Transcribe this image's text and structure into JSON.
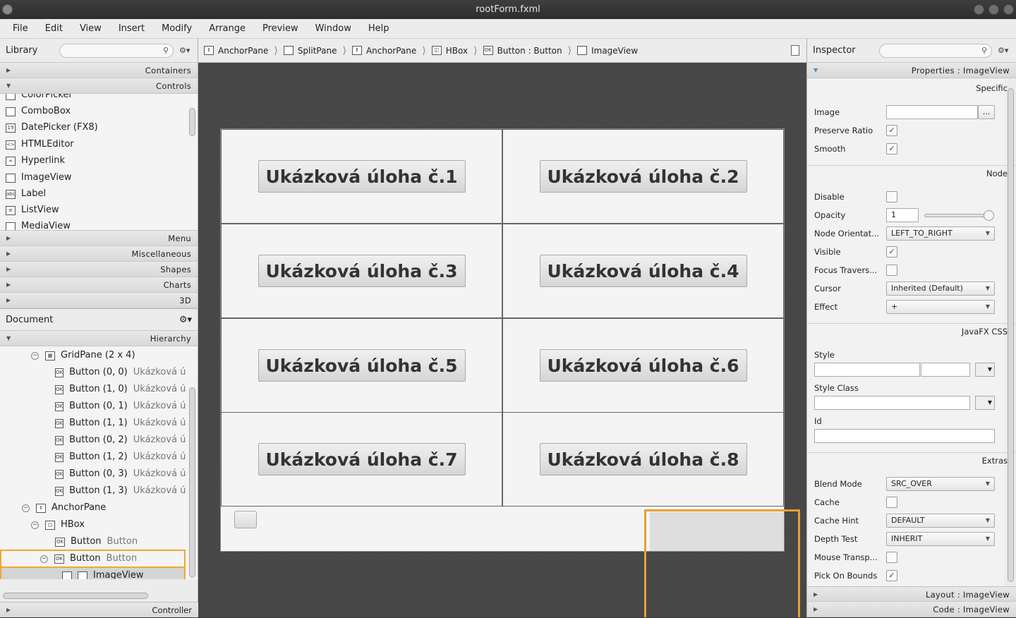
{
  "window": {
    "title": "rootForm.fxml"
  },
  "menu": [
    "File",
    "Edit",
    "View",
    "Insert",
    "Modify",
    "Arrange",
    "Preview",
    "Window",
    "Help"
  ],
  "library": {
    "title": "Library",
    "sections_top": [
      "Containers",
      "Controls"
    ],
    "items": [
      "ColorPicker",
      "ComboBox",
      "DatePicker  (FX8)",
      "HTMLEditor",
      "Hyperlink",
      "ImageView",
      "Label",
      "ListView",
      "MediaView"
    ],
    "item_icons": [
      "color-picker-icon",
      "combobox-icon",
      "datepicker-icon",
      "htmleditor-icon",
      "hyperlink-icon",
      "imageview-icon",
      "label-icon",
      "listview-icon",
      "mediaview-icon"
    ],
    "sections_bottom": [
      "Menu",
      "Miscellaneous",
      "Shapes",
      "Charts",
      "3D"
    ]
  },
  "document": {
    "title": "Document",
    "hierarchy_label": "Hierarchy",
    "rows": [
      {
        "label": "GridPane (2 x 4)",
        "caption": ""
      },
      {
        "label": "Button (0, 0)",
        "caption": "Ukázková ú"
      },
      {
        "label": "Button (1, 0)",
        "caption": "Ukázková ú"
      },
      {
        "label": "Button (0, 1)",
        "caption": "Ukázková ú"
      },
      {
        "label": "Button (1, 1)",
        "caption": "Ukázková ú"
      },
      {
        "label": "Button (0, 2)",
        "caption": "Ukázková ú"
      },
      {
        "label": "Button (1, 2)",
        "caption": "Ukázková ú"
      },
      {
        "label": "Button (0, 3)",
        "caption": "Ukázková ú"
      },
      {
        "label": "Button (1, 3)",
        "caption": "Ukázková ú"
      },
      {
        "label": "AnchorPane",
        "caption": ""
      },
      {
        "label": "HBox",
        "caption": ""
      },
      {
        "label": "Button",
        "caption": "Button"
      },
      {
        "label": "Button",
        "caption": "Button"
      },
      {
        "label": "ImageView",
        "caption": ""
      }
    ],
    "controller_label": "Controller"
  },
  "breadcrumb": [
    "AnchorPane",
    "SplitPane",
    "AnchorPane",
    "HBox",
    "Button : Button",
    "ImageView"
  ],
  "canvas": {
    "buttons": [
      "Ukázková úloha č.1",
      "Ukázková úloha č.2",
      "Ukázková úloha č.3",
      "Ukázková úloha č.4",
      "Ukázková úloha č.5",
      "Ukázková úloha č.6",
      "Ukázková úloha č.7",
      "Ukázková úloha č.8"
    ]
  },
  "inspector": {
    "title": "Inspector",
    "properties_label": "Properties : ImageView",
    "specific_label": "Specific",
    "image_label": "Image",
    "image_browse": "...",
    "preserve_label": "Preserve Ratio",
    "smooth_label": "Smooth",
    "node_label": "Node",
    "disable_label": "Disable",
    "opacity_label": "Opacity",
    "opacity_value": "1",
    "orient_label": "Node Orientat...",
    "orient_value": "LEFT_TO_RIGHT",
    "visible_label": "Visible",
    "focus_label": "Focus Travers...",
    "cursor_label": "Cursor",
    "cursor_value": "Inherited (Default)",
    "effect_label": "Effect",
    "effect_value": "+",
    "css_label": "JavaFX CSS",
    "style_label": "Style",
    "styleclass_label": "Style Class",
    "id_label": "Id",
    "extras_label": "Extras",
    "blend_label": "Blend Mode",
    "blend_value": "SRC_OVER",
    "cache_label": "Cache",
    "cachehint_label": "Cache Hint",
    "cachehint_value": "DEFAULT",
    "depth_label": "Depth Test",
    "depth_value": "INHERIT",
    "mouse_label": "Mouse Transp...",
    "pick_label": "Pick On Bounds",
    "layout_label": "Layout : ImageView",
    "code_label": "Code : ImageView",
    "check_glyph": "✓"
  }
}
